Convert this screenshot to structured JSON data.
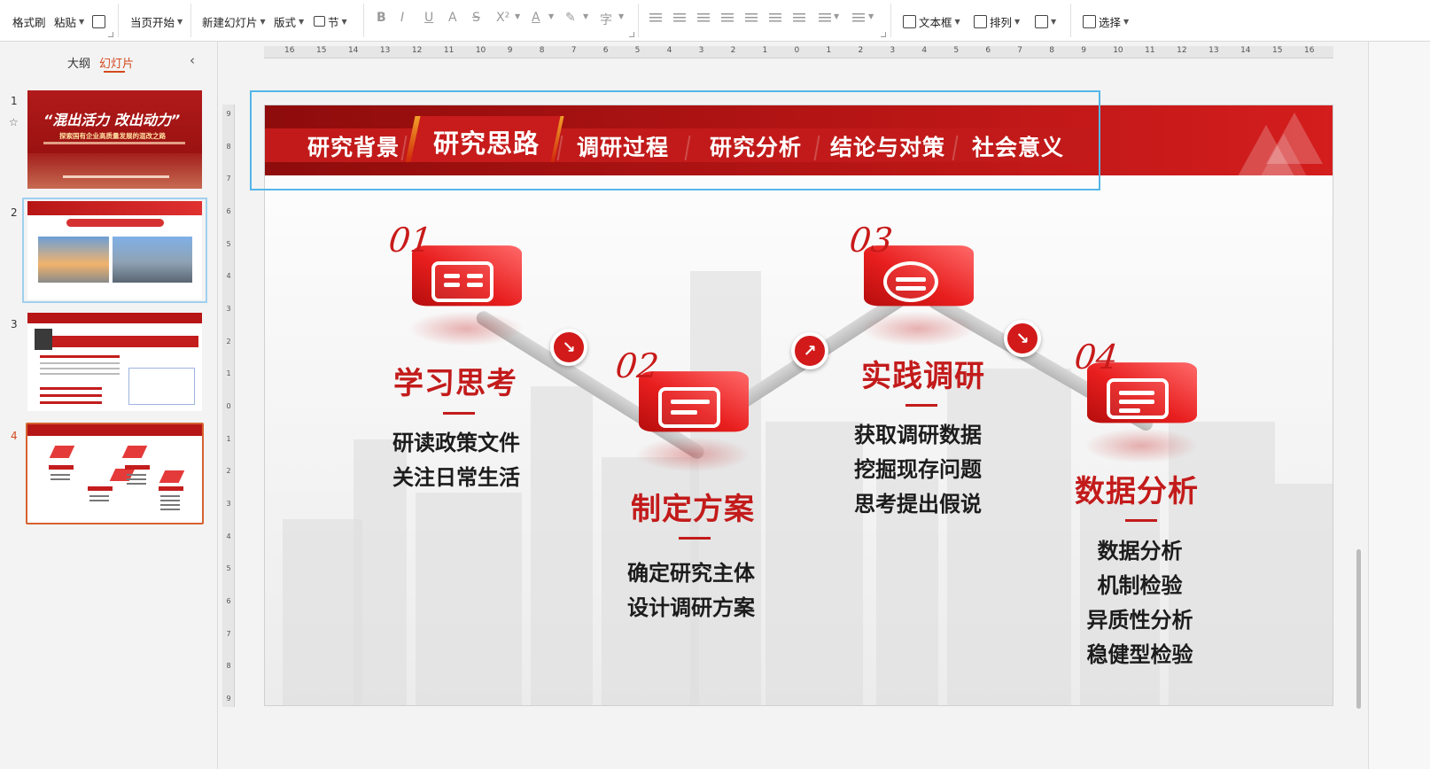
{
  "ribbon": {
    "format_painter": "格式刷",
    "paste": "粘贴",
    "from_current": "当页开始",
    "new_slide": "新建幻灯片",
    "layout": "版式",
    "section": "节",
    "text_box": "文本框",
    "arrange": "排列",
    "select": "选择",
    "format_buttons": [
      "B",
      "I",
      "U",
      "A",
      "S",
      "X²",
      "A"
    ]
  },
  "left_panel": {
    "tab_outline": "大纲",
    "tab_slides": "幻灯片",
    "collapse_icon": "chevron-left-icon",
    "slide_numbers": [
      "1",
      "2",
      "3",
      "4"
    ],
    "current_slide": 4,
    "thumb1": {
      "title": "“混出活力 改出动力”",
      "subtitle": "探索国有企业高质量发展的混改之路"
    }
  },
  "rulers": {
    "h_labels": [
      "16",
      "15",
      "14",
      "13",
      "12",
      "11",
      "10",
      "9",
      "8",
      "7",
      "6",
      "5",
      "4",
      "3",
      "2",
      "1",
      "0",
      "1",
      "2",
      "3",
      "4",
      "5",
      "6",
      "7",
      "8",
      "9",
      "10",
      "11",
      "12",
      "13",
      "14",
      "15",
      "16"
    ],
    "v_labels": [
      "9",
      "8",
      "7",
      "6",
      "5",
      "4",
      "3",
      "2",
      "1",
      "0",
      "1",
      "2",
      "3",
      "4",
      "5",
      "6",
      "7",
      "8",
      "9"
    ]
  },
  "slide": {
    "nav_tabs": [
      "研究背景",
      "研究思路",
      "调研过程",
      "研究分析",
      "结论与对策",
      "社会意义"
    ],
    "active_tab_index": 1,
    "steps": [
      {
        "num": "01",
        "title": "学习思考",
        "items": [
          "研读政策文件",
          "关注日常生活"
        ],
        "icon": "book-icon"
      },
      {
        "num": "02",
        "title": "制定方案",
        "items": [
          "确定研究主体",
          "设计调研方案"
        ],
        "icon": "presentation-icon"
      },
      {
        "num": "03",
        "title": "实践调研",
        "items": [
          "获取调研数据",
          "挖掘现存问题",
          "思考提出假说"
        ],
        "icon": "data-cycle-icon"
      },
      {
        "num": "04",
        "title": "数据分析",
        "items": [
          "数据分析",
          "机制检验",
          "异质性分析",
          "稳健型检验"
        ],
        "icon": "document-icon"
      }
    ],
    "colors": {
      "accent_red": "#c31b1b",
      "header_red": "#b31414",
      "selection_blue": "#54b6e8"
    }
  }
}
